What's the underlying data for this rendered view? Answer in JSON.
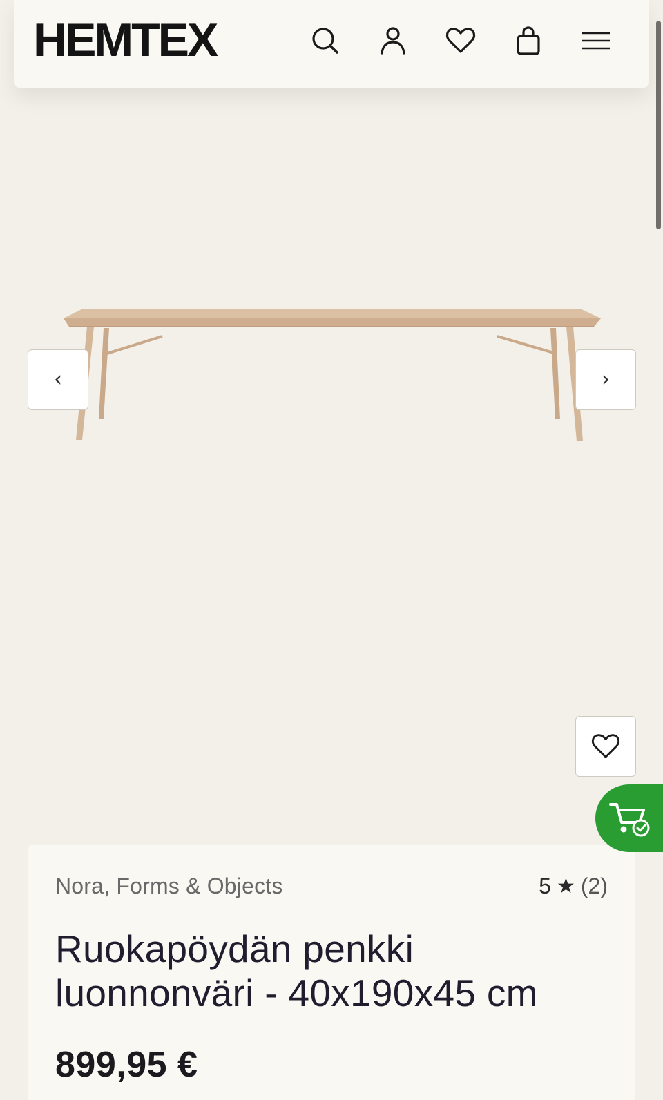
{
  "header": {
    "logo": "HEMTEX",
    "icons": [
      "search-icon",
      "account-icon",
      "heart-icon",
      "bag-icon",
      "menu-icon"
    ]
  },
  "gallery": {
    "prev_label": "‹",
    "next_label": "›",
    "image_subject": "wooden dining bench, natural colour"
  },
  "cart_button": {
    "color": "#2a9d32"
  },
  "product": {
    "brand": "Nora, Forms & Objects",
    "rating_value": "5",
    "rating_star": "★",
    "rating_count": "(2)",
    "title_line1": "Ruokapöydän penkki",
    "title_line2": "luonnonväri - 40x190x45 cm",
    "price": "899,95 €"
  },
  "colors": {
    "background": "#f3f0e9",
    "card": "#faf8f2",
    "accent_green": "#2a9d32",
    "wood": "#d9bc9f"
  }
}
